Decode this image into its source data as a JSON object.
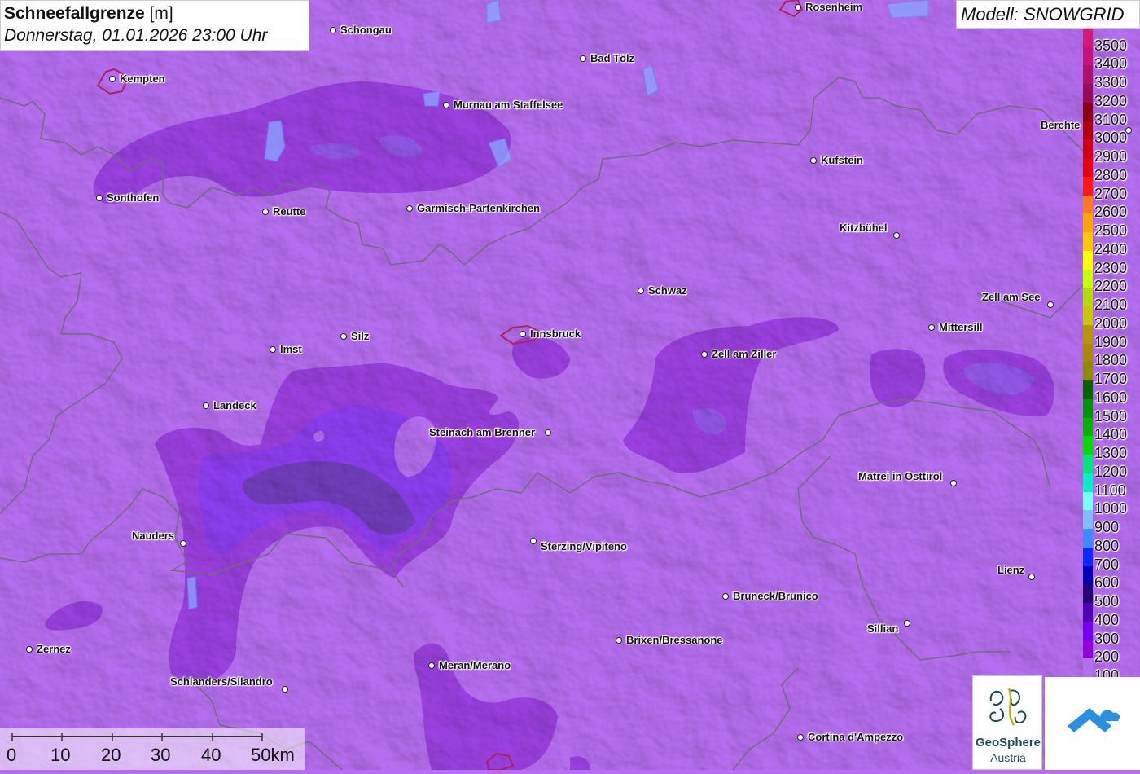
{
  "header": {
    "title_bold": "Schneefallgrenze",
    "title_unit": "[m]",
    "datetime": "Donnerstag, 01.01.2026 23:00 Uhr",
    "model": "Modell: SNOWGRID"
  },
  "cities": [
    {
      "name": "Schongau"
    },
    {
      "name": "Rosenheim"
    },
    {
      "name": "Kempten"
    },
    {
      "name": "Bad Tölz"
    },
    {
      "name": "Murnau am Staffelsee"
    },
    {
      "name": "Berchte"
    },
    {
      "name": "Kufstein"
    },
    {
      "name": "Sonthofen"
    },
    {
      "name": "Reutte"
    },
    {
      "name": "Garmisch-Partenkirchen"
    },
    {
      "name": "Kitzbühel"
    },
    {
      "name": "Schwaz"
    },
    {
      "name": "Zell am See"
    },
    {
      "name": "Mittersill"
    },
    {
      "name": "Imst"
    },
    {
      "name": "Silz"
    },
    {
      "name": "Innsbruck"
    },
    {
      "name": "Zell am Ziller"
    },
    {
      "name": "Landeck"
    },
    {
      "name": "Steinach am Brenner"
    },
    {
      "name": "Matrei in Osttirol"
    },
    {
      "name": "Nauders"
    },
    {
      "name": "Sterzing/Vipiteno"
    },
    {
      "name": "Lienz"
    },
    {
      "name": "Bruneck/Brunico"
    },
    {
      "name": "Sillian"
    },
    {
      "name": "Zernez"
    },
    {
      "name": "Brixen/Bressanone"
    },
    {
      "name": "Meran/Merano"
    },
    {
      "name": "Schlanders/Silandro"
    },
    {
      "name": "Cortina d'Ampezzo"
    }
  ],
  "legend": {
    "items": [
      {
        "label": "3500",
        "color": "#d4197a"
      },
      {
        "label": "3400",
        "color": "#c8147a"
      },
      {
        "label": "3300",
        "color": "#b01070"
      },
      {
        "label": "3200",
        "color": "#980a5a"
      },
      {
        "label": "3100",
        "color": "#8a0010"
      },
      {
        "label": "3000",
        "color": "#b00010"
      },
      {
        "label": "2900",
        "color": "#d00010"
      },
      {
        "label": "2800",
        "color": "#e80010"
      },
      {
        "label": "2700",
        "color": "#ff1818"
      },
      {
        "label": "2600",
        "color": "#ff7a1a"
      },
      {
        "label": "2500",
        "color": "#ffa500"
      },
      {
        "label": "2400",
        "color": "#ffc800"
      },
      {
        "label": "2300",
        "color": "#ffff00"
      },
      {
        "label": "2200",
        "color": "#c8ff00"
      },
      {
        "label": "2100",
        "color": "#b4dc00"
      },
      {
        "label": "2000",
        "color": "#c8c800"
      },
      {
        "label": "1900",
        "color": "#b89600"
      },
      {
        "label": "1800",
        "color": "#a88a00"
      },
      {
        "label": "1700",
        "color": "#8c8c00"
      },
      {
        "label": "1600",
        "color": "#006400"
      },
      {
        "label": "1500",
        "color": "#009600"
      },
      {
        "label": "1400",
        "color": "#00b400"
      },
      {
        "label": "1300",
        "color": "#00dc00"
      },
      {
        "label": "1200",
        "color": "#00e67a"
      },
      {
        "label": "1100",
        "color": "#00f0c8"
      },
      {
        "label": "1000",
        "color": "#78ffff"
      },
      {
        "label": "900",
        "color": "#82beff"
      },
      {
        "label": "800",
        "color": "#3c8cff"
      },
      {
        "label": "700",
        "color": "#0a28ff"
      },
      {
        "label": "600",
        "color": "#0000b4"
      },
      {
        "label": "500",
        "color": "#280078"
      },
      {
        "label": "400",
        "color": "#5000b4"
      },
      {
        "label": "300",
        "color": "#7800f0"
      },
      {
        "label": "200",
        "color": "#9600dc"
      },
      {
        "label": "100",
        "color": "#b46ef0"
      }
    ]
  },
  "scale_bar": {
    "labels": [
      "0",
      "10",
      "20",
      "30",
      "40",
      "50km"
    ]
  },
  "logos": {
    "geosphere_line1": "GeoSphere",
    "geosphere_line2": "Austria"
  },
  "colors": {
    "background": "#b66ef0",
    "border_lines": "#6e6e78",
    "lake": "#8aa8ff"
  }
}
